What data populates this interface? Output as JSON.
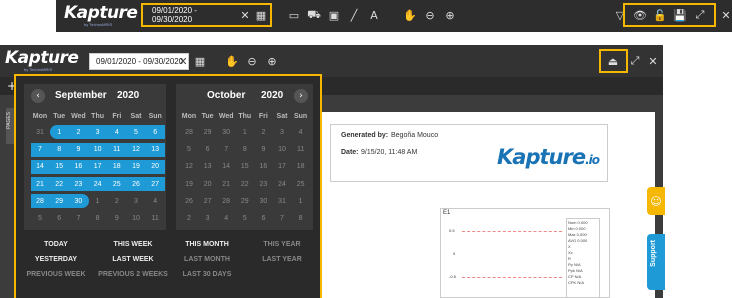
{
  "top_toolbar": {
    "logo": "Kapture",
    "logo_sub": "by TechnoMRIS",
    "date_range": "09/01/2020 - 09/30/2020"
  },
  "second_toolbar": {
    "logo": "Kapture",
    "logo_sub": "by TechnoMRIS",
    "date_range": "09/01/2020 - 09/30/2020",
    "side_tab": "PAGES"
  },
  "calendar": {
    "left": {
      "month": "September",
      "year": "2020",
      "dow": [
        "Mon",
        "Tue",
        "Wed",
        "Thu",
        "Fri",
        "Sat",
        "Sun"
      ],
      "weeks": [
        [
          "31",
          "1",
          "2",
          "3",
          "4",
          "5",
          "6"
        ],
        [
          "7",
          "8",
          "9",
          "10",
          "11",
          "12",
          "13"
        ],
        [
          "14",
          "15",
          "16",
          "17",
          "18",
          "19",
          "20"
        ],
        [
          "21",
          "22",
          "23",
          "24",
          "25",
          "26",
          "27"
        ],
        [
          "28",
          "29",
          "30",
          "1",
          "2",
          "3",
          "4"
        ],
        [
          "5",
          "6",
          "7",
          "8",
          "9",
          "10",
          "11"
        ]
      ]
    },
    "right": {
      "month": "October",
      "year": "2020",
      "dow": [
        "Mon",
        "Tue",
        "Wed",
        "Thu",
        "Fri",
        "Sat",
        "Sun"
      ],
      "weeks": [
        [
          "28",
          "29",
          "30",
          "1",
          "2",
          "3",
          "4"
        ],
        [
          "5",
          "6",
          "7",
          "8",
          "9",
          "10",
          "11"
        ],
        [
          "12",
          "13",
          "14",
          "15",
          "16",
          "17",
          "18"
        ],
        [
          "19",
          "20",
          "21",
          "22",
          "23",
          "24",
          "25"
        ],
        [
          "26",
          "27",
          "28",
          "29",
          "30",
          "31",
          "1"
        ],
        [
          "2",
          "3",
          "4",
          "5",
          "6",
          "7",
          "8"
        ]
      ]
    },
    "quick": [
      [
        "TODAY",
        "THIS WEEK",
        "THIS MONTH",
        "THIS YEAR"
      ],
      [
        "YESTERDAY",
        "LAST WEEK",
        "LAST MONTH",
        "LAST YEAR"
      ],
      [
        "PREVIOUS WEEK",
        "PREVIOUS 2 WEEKS",
        "LAST 30 DAYS",
        ""
      ]
    ]
  },
  "report": {
    "generated_by_label": "Generated by:",
    "generated_by": "Begoña Mouco",
    "date_label": "Date:",
    "date": "9/15/20, 11:48 AM",
    "brand": "Kapture",
    "brand_tld": ".io",
    "chart_title": "E1",
    "y_ticks": [
      "0.5",
      "0",
      "-0.5"
    ],
    "stats": [
      "Nom 0.000",
      "Min 0.000",
      "Max 0.000",
      "AVG 0.000",
      "X",
      "Xc",
      "R",
      "Pp N/A",
      "Ppk N/A",
      "CP N/A",
      "CPK N/A"
    ]
  },
  "side": {
    "support": "Support"
  },
  "colors": {
    "accent": "#1e9ad6",
    "highlight": "#f5b700"
  }
}
